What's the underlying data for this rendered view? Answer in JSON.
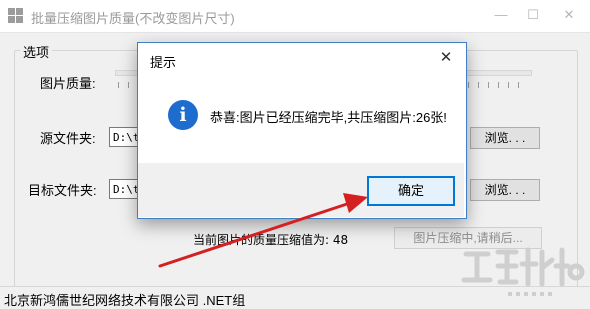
{
  "window": {
    "title": "批量压缩图片质量(不改变图片尺寸)",
    "controls": {
      "minimize": "—",
      "maximize": "☐",
      "close": "✕"
    }
  },
  "options_group": {
    "label": "选项"
  },
  "quality": {
    "label": "图片质量:"
  },
  "source": {
    "label": "源文件夹:",
    "path": "D:\\tc",
    "browse_label": "浏览. . ."
  },
  "target": {
    "label": "目标文件夹:",
    "path": "D:\\tc",
    "browse_label": "浏览. . ."
  },
  "current_quality": {
    "text": "当前图片的质量压缩值为: 48"
  },
  "compress_button": {
    "label": "图片压缩中,请稍后..."
  },
  "status_bar": {
    "text": "北京新鸿儒世纪网络技术有限公司 .NET组"
  },
  "dialog": {
    "title": "提示",
    "close": "✕",
    "icon": "information-icon",
    "message": "恭喜:图片已经压缩完毕,共压缩图片:26张!",
    "ok_label": "确定"
  },
  "colors": {
    "dialog_border": "#3f7fc6",
    "info_icon": "#1e6ccd",
    "ok_border": "#0078d7",
    "arrow": "#d42020"
  }
}
